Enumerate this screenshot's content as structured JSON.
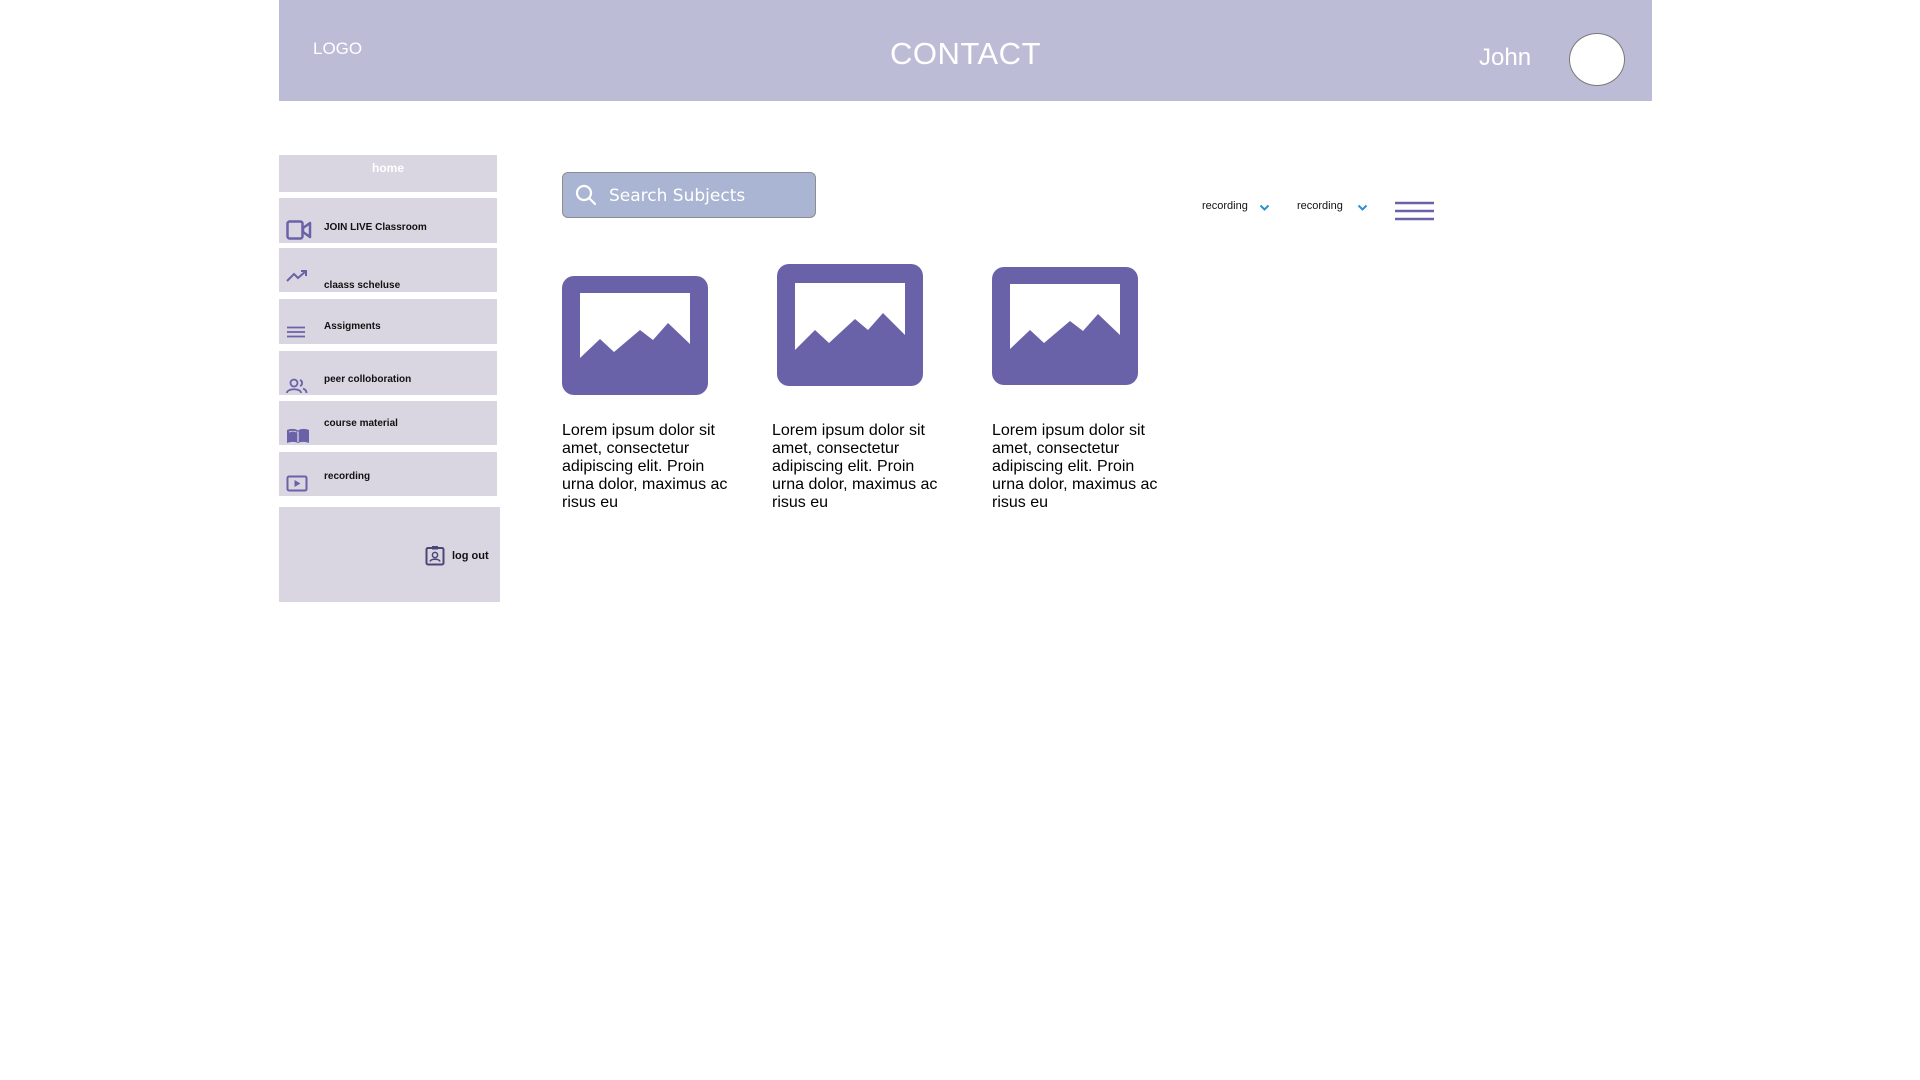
{
  "header": {
    "logo": "LOGO",
    "title": "CONTACT",
    "username": "John"
  },
  "sidebar": {
    "home": "home",
    "items": [
      {
        "label": "JOIN LIVE Classroom",
        "icon": "video-camera-icon"
      },
      {
        "label": "claass scheluse",
        "icon": "trending-up-icon"
      },
      {
        "label": "Assigments",
        "icon": "lines-icon"
      },
      {
        "label": "peer colloboration",
        "icon": "people-icon"
      },
      {
        "label": "course material",
        "icon": "open-book-icon"
      },
      {
        "label": "recording",
        "icon": "play-icon"
      }
    ],
    "logout": "log out"
  },
  "search": {
    "placeholder": "Search Subjects"
  },
  "filters": [
    {
      "label": "recording"
    },
    {
      "label": "recording"
    }
  ],
  "cards": [
    {
      "text": "Lorem ipsum dolor sit amet, consectetur adipiscing elit. Proin urna dolor, maximus ac risus eu"
    },
    {
      "text": "Lorem ipsum dolor sit amet, consectetur adipiscing elit. Proin urna dolor, maximus ac risus eu"
    },
    {
      "text": "Lorem ipsum dolor sit amet, consectetur adipiscing elit. Proin urna dolor, maximus ac risus eu"
    }
  ],
  "colors": {
    "header_bg": "#bdbcd6",
    "sidebar_bg": "#dad6e1",
    "accent": "#6a62a8",
    "search_bg": "#aab5d3",
    "chevron": "#2b8fd0"
  }
}
